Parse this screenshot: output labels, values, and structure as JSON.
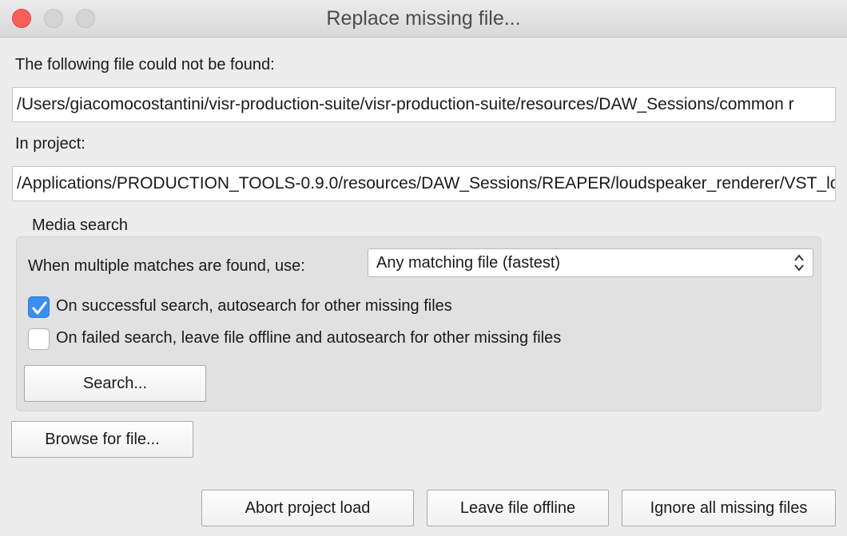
{
  "window": {
    "title": "Replace missing file..."
  },
  "missing_file": {
    "label": "The following file could not be found:",
    "path": "/Users/giacomocostantini/visr-production-suite/visr-production-suite/resources/DAW_Sessions/common r"
  },
  "project": {
    "label": "In project:",
    "path": "/Applications/PRODUCTION_TOOLS-0.9.0/resources/DAW_Sessions/REAPER/loudspeaker_renderer/VST_lo"
  },
  "media_search": {
    "heading": "Media search",
    "multiple_matches_label": "When multiple matches are found, use:",
    "multiple_matches_selected": "Any matching file (fastest)",
    "checkbox_success": {
      "label": "On successful search, autosearch for other missing files",
      "checked": true
    },
    "checkbox_failed": {
      "label": "On failed search, leave file offline and autosearch for other missing files",
      "checked": false
    },
    "search_button": "Search..."
  },
  "buttons": {
    "browse": "Browse for file...",
    "abort": "Abort project load",
    "leave_offline": "Leave file offline",
    "ignore_all": "Ignore all missing files"
  },
  "colors": {
    "accent": "#3b8ef0",
    "close_button": "#fc5f57",
    "window_bg": "#ececec"
  }
}
